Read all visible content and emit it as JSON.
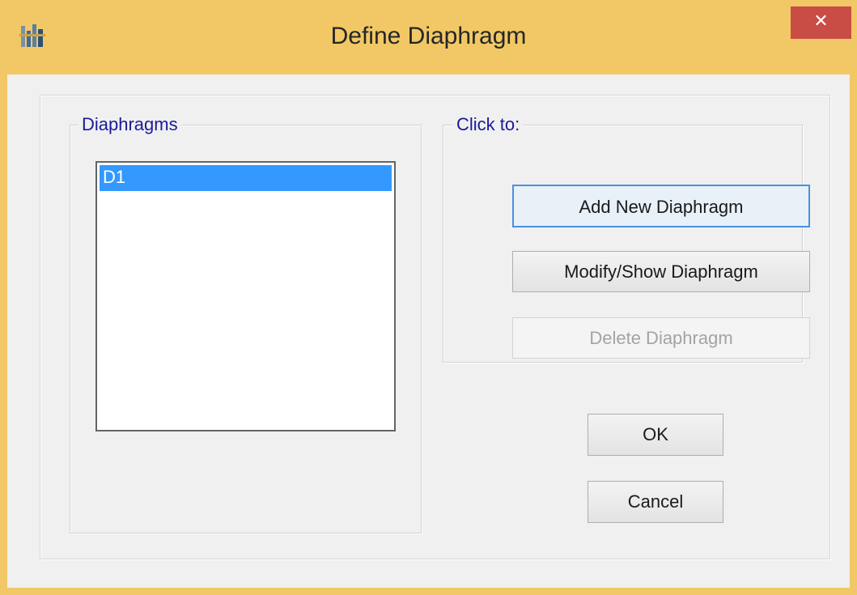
{
  "window": {
    "title": "Define Diaphragm",
    "close_glyph": "✕",
    "app_icon": "etabs-app-icon"
  },
  "diaphragms_group": {
    "legend": "Diaphragms",
    "items": [
      {
        "label": "D1",
        "selected": true
      }
    ]
  },
  "clickto_group": {
    "legend": "Click to:",
    "add_label": "Add New Diaphragm",
    "modify_label": "Modify/Show Diaphragm",
    "delete_label": "Delete Diaphragm",
    "delete_enabled": false
  },
  "footer": {
    "ok_label": "OK",
    "cancel_label": "Cancel"
  },
  "colors": {
    "titlebar": "#f1c865",
    "close_button": "#c94c45",
    "selection": "#3399ff",
    "legend_text": "#1a1a9c"
  }
}
